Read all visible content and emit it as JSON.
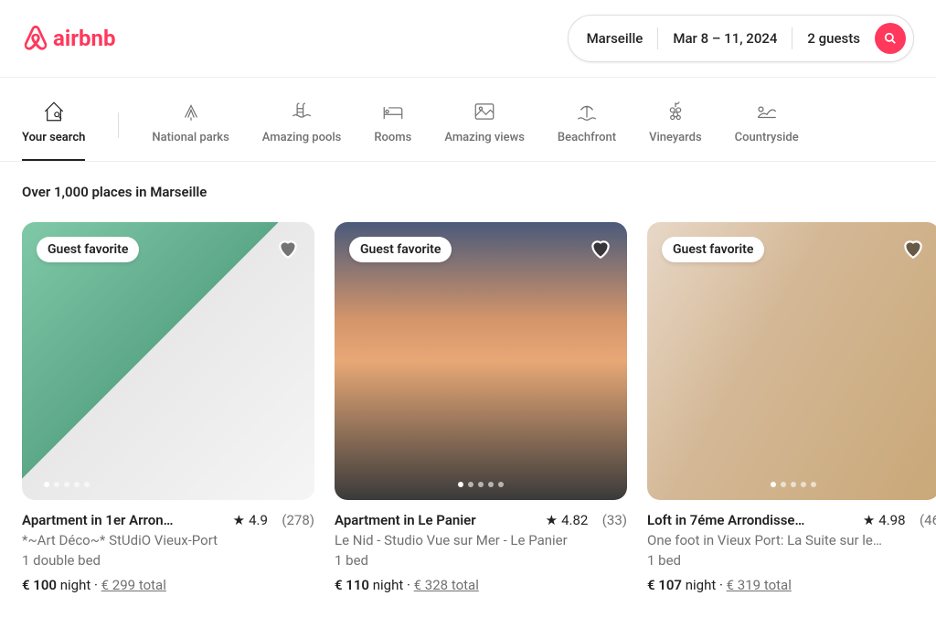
{
  "brand": "airbnb",
  "search": {
    "location": "Marseille",
    "dates": "Mar 8 – 11, 2024",
    "guests": "2 guests"
  },
  "categories": [
    {
      "label": "Your search",
      "active": true
    },
    {
      "label": "National parks"
    },
    {
      "label": "Amazing pools"
    },
    {
      "label": "Rooms"
    },
    {
      "label": "Amazing views"
    },
    {
      "label": "Beachfront"
    },
    {
      "label": "Vineyards"
    },
    {
      "label": "Countryside"
    }
  ],
  "results_header": "Over 1,000 places in Marseille",
  "badge_label": "Guest favorite",
  "listings": [
    {
      "title": "Apartment in 1er Arron…",
      "rating": "4.9",
      "reviews": "(278)",
      "subtitle": "*~Art Déco~* StUdiO Vieux-Port",
      "beds": "1 double bed",
      "price": "€ 100",
      "price_unit": "night",
      "total": "€ 299 total",
      "dots": [
        1,
        0,
        0,
        0,
        0
      ],
      "dots_align": "left"
    },
    {
      "title": "Apartment in Le Panier",
      "rating": "4.82",
      "reviews": "(33)",
      "subtitle": "Le Nid - Studio Vue sur Mer - Le Panier",
      "beds": "1 bed",
      "price": "€ 110",
      "price_unit": "night",
      "total": "€ 328 total",
      "dots": [
        1,
        0,
        0,
        0,
        0
      ],
      "dots_align": "center"
    },
    {
      "title": "Loft in 7éme Arrondisse…",
      "rating": "4.98",
      "reviews": "(46",
      "subtitle": "One foot in Vieux Port: La Suite sur le…",
      "beds": "1 bed",
      "price": "€ 107",
      "price_unit": "night",
      "total": "€ 319 total",
      "dots": [
        1,
        0,
        0,
        0,
        0
      ],
      "dots_align": "center"
    }
  ]
}
